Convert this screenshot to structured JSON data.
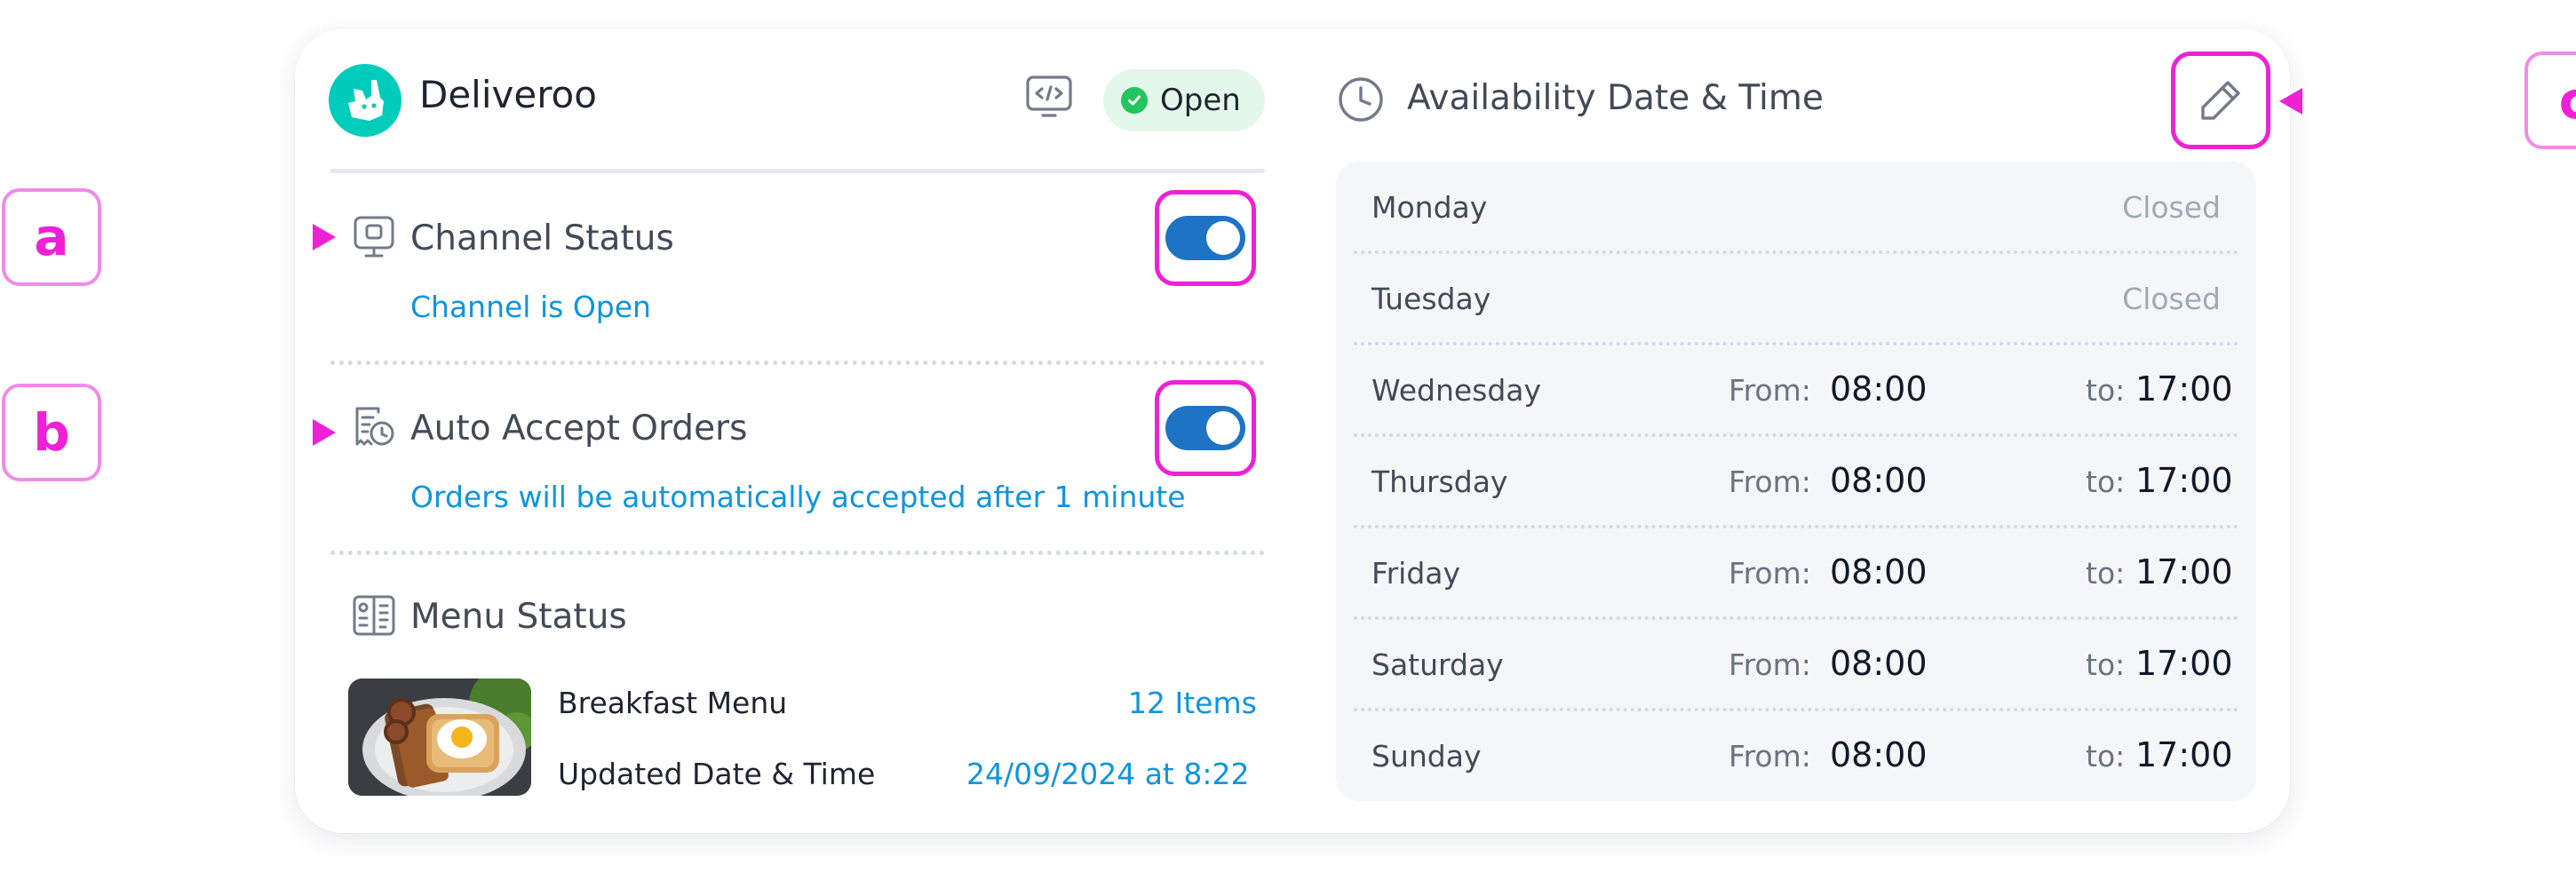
{
  "channel": {
    "name": "Deliveroo",
    "status_badge": "Open",
    "icons": {
      "logo": "deliveroo-kangaroo-logo",
      "embed": "code-embed-icon",
      "badge": "check-circle-icon"
    }
  },
  "sections": {
    "channel_status": {
      "title": "Channel Status",
      "subtitle": "Channel is Open",
      "toggle_on": true,
      "icon": "kiosk-monitor-icon"
    },
    "auto_accept": {
      "title": "Auto Accept Orders",
      "subtitle": "Orders will be automatically accepted after 1 minute",
      "toggle_on": true,
      "icon": "receipt-clock-icon"
    },
    "menu_status": {
      "title": "Menu Status",
      "icon": "menu-book-icon",
      "menu_name": "Breakfast Menu",
      "item_count": "12 Items",
      "updated_label": "Updated Date & Time",
      "updated_value": "24/09/2024 at 8:22"
    }
  },
  "availability": {
    "title": "Availability Date & Time",
    "icon": "clock-icon",
    "edit_icon": "pencil-icon",
    "from_label": "From:",
    "to_label": "to:",
    "days": [
      {
        "day": "Monday",
        "closed": true,
        "closed_label": "Closed"
      },
      {
        "day": "Tuesday",
        "closed": true,
        "closed_label": "Closed"
      },
      {
        "day": "Wednesday",
        "closed": false,
        "from": "08:00",
        "to": "17:00"
      },
      {
        "day": "Thursday",
        "closed": false,
        "from": "08:00",
        "to": "17:00"
      },
      {
        "day": "Friday",
        "closed": false,
        "from": "08:00",
        "to": "17:00"
      },
      {
        "day": "Saturday",
        "closed": false,
        "from": "08:00",
        "to": "17:00"
      },
      {
        "day": "Sunday",
        "closed": false,
        "from": "08:00",
        "to": "17:00"
      }
    ]
  },
  "annotations": {
    "a": "a",
    "b": "b",
    "c": "c"
  },
  "colors": {
    "accent": "#1e73c4",
    "link": "#0e95df",
    "brand": "#00ccbc",
    "annotation": "#ee21d6",
    "success": "#22c55e"
  }
}
